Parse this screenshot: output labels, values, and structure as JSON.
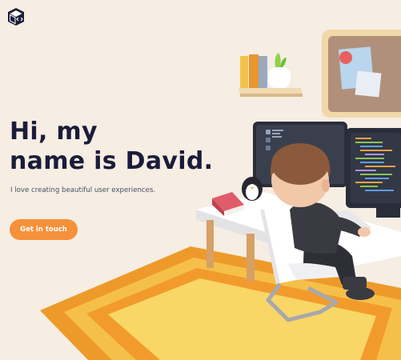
{
  "hero": {
    "title_line1": "Hi, my",
    "title_line2": "name is David.",
    "subtitle": "I love creating beautiful user experiences.",
    "cta_label": "Get in touch"
  },
  "icons": {
    "logo": "cube-code-logo"
  },
  "colors": {
    "background": "#f6ede3",
    "accent": "#f5913a",
    "title": "#1a1c3a",
    "rug_outer": "#f0a02c",
    "rug_inner": "#f8d35c"
  }
}
